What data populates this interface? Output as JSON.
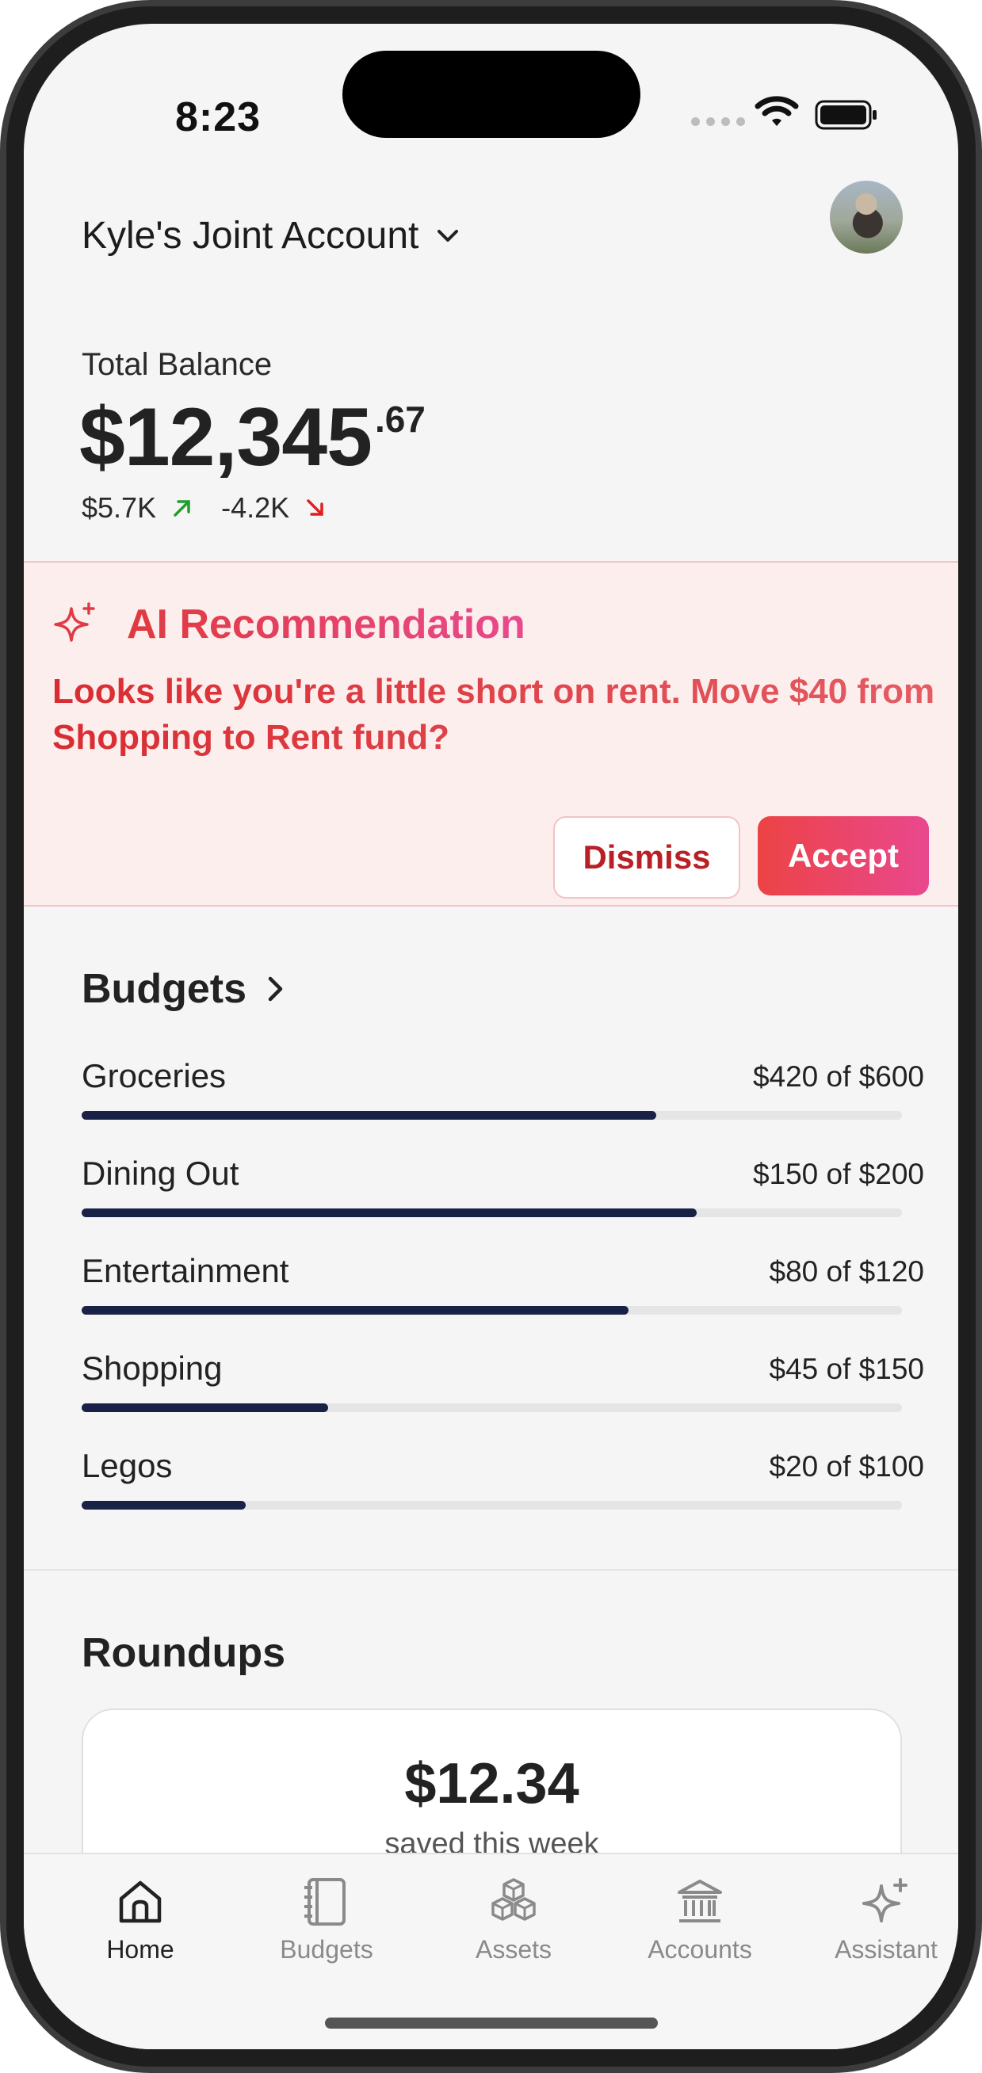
{
  "status_bar": {
    "time": "8:23"
  },
  "header": {
    "account_name": "Kyle's Joint Account"
  },
  "balance": {
    "label": "Total Balance",
    "dollars": "$12,345",
    "cents": ".67",
    "inflow": "$5.7K",
    "outflow": "-4.2K",
    "inflow_color": "#1f9d2f",
    "outflow_color": "#e02020"
  },
  "ai_recommendation": {
    "title": "AI Recommendation",
    "message": "Looks like you're a little short on rent. Move $40 from Shopping to Rent fund?",
    "dismiss_label": "Dismiss",
    "accept_label": "Accept",
    "accent_color": "#e03a3e"
  },
  "budgets": {
    "title": "Budgets",
    "items": [
      {
        "name": "Groceries",
        "amount": "$420 of $600",
        "progress": 0.7
      },
      {
        "name": "Dining Out",
        "amount": "$150 of $200",
        "progress": 0.75
      },
      {
        "name": "Entertainment",
        "amount": "$80 of $120",
        "progress": 0.667
      },
      {
        "name": "Shopping",
        "amount": "$45 of $150",
        "progress": 0.3
      },
      {
        "name": "Legos",
        "amount": "$20 of $100",
        "progress": 0.2
      }
    ],
    "bar_color": "#1a2147"
  },
  "roundups": {
    "title": "Roundups",
    "amount": "$12.34",
    "subtitle": "saved this week"
  },
  "tab_bar": {
    "tabs": [
      {
        "label": "Home",
        "icon": "home-icon",
        "active": true
      },
      {
        "label": "Budgets",
        "icon": "notebook-icon",
        "active": false
      },
      {
        "label": "Assets",
        "icon": "cubes-icon",
        "active": false
      },
      {
        "label": "Accounts",
        "icon": "bank-icon",
        "active": false
      },
      {
        "label": "Assistant",
        "icon": "sparkle-icon",
        "active": false
      }
    ],
    "active_color": "#222222",
    "inactive_color": "#8a8a8a"
  }
}
